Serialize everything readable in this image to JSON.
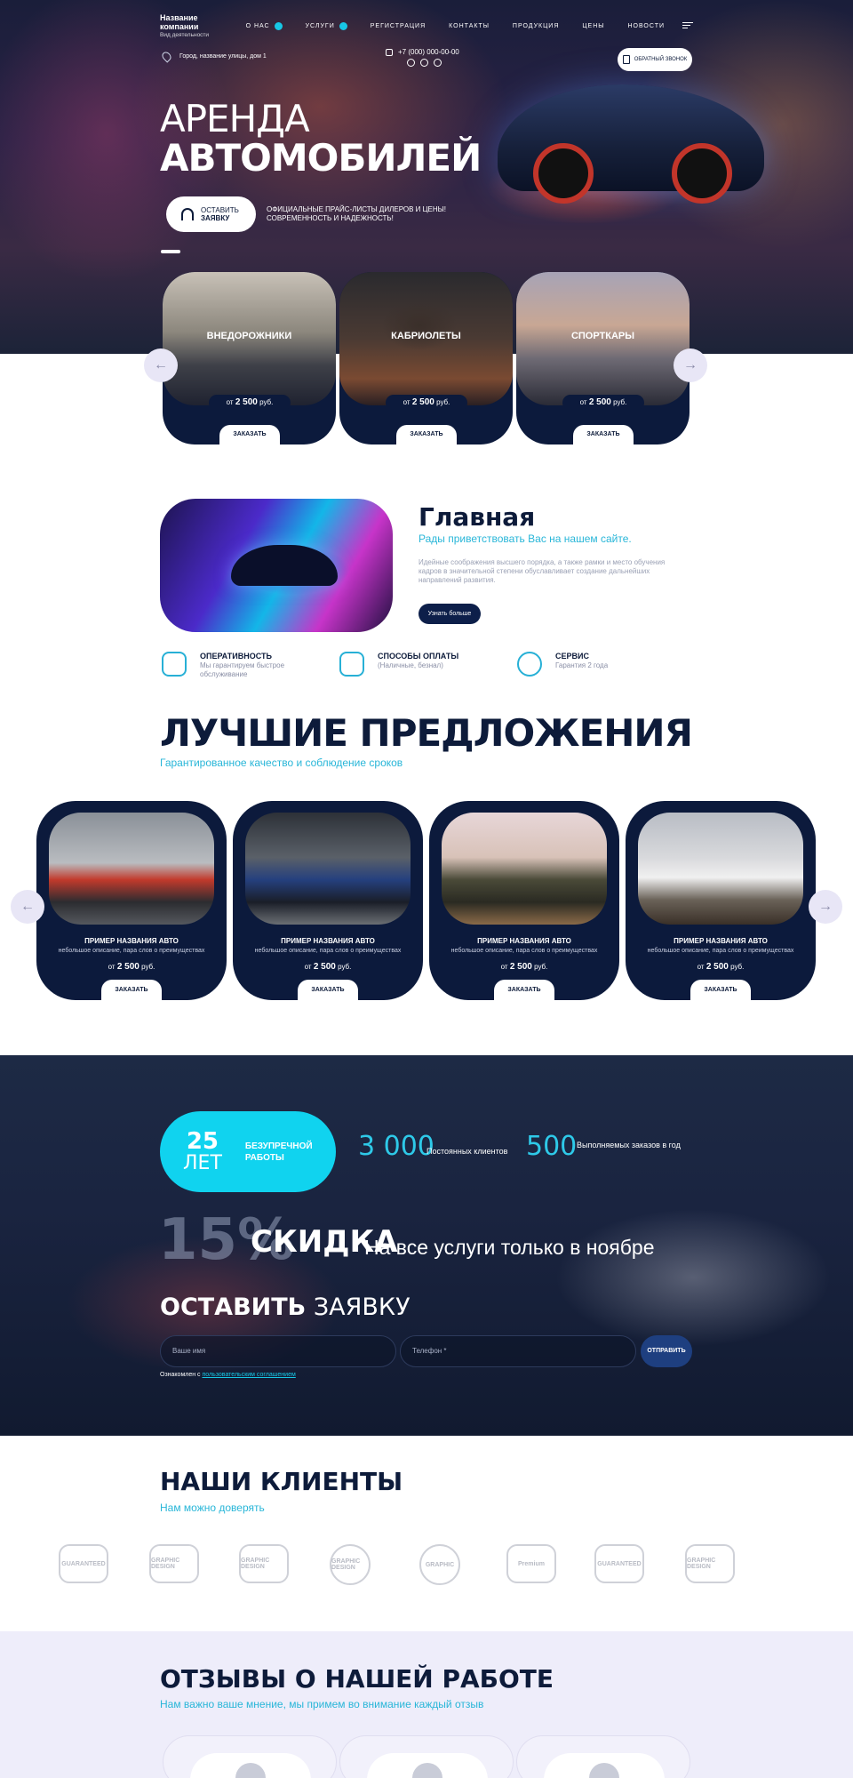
{
  "header": {
    "company_name": "Название компании",
    "company_sub": "Вид деятельности",
    "menu": [
      {
        "label": "О НАС",
        "has_dropdown": true
      },
      {
        "label": "УСЛУГИ",
        "has_dropdown": true
      },
      {
        "label": "РЕГИСТРАЦИЯ",
        "has_dropdown": false
      },
      {
        "label": "КОНТАКТЫ",
        "has_dropdown": false
      },
      {
        "label": "ПРОДУКЦИЯ",
        "has_dropdown": false
      },
      {
        "label": "ЦЕНЫ",
        "has_dropdown": false
      },
      {
        "label": "НОВОСТИ",
        "has_dropdown": false
      }
    ],
    "address": "Город, название улицы, дом 1",
    "phone": "+7 (000) 000-00-00",
    "callback_label": "ОБРАТНЫЙ ЗВОНОК",
    "icons": {
      "address": "map-pin-icon",
      "phone": "phone-icon",
      "callback": "document-icon",
      "menu": "hamburger-icon"
    }
  },
  "hero": {
    "title_line1": "АРЕНДА",
    "title_line2": "АВТОМОБИЛЕЙ",
    "cta_line1": "ОСТАВИТЬ",
    "cta_line2": "ЗАЯВКУ",
    "note": "ОФИЦИАЛЬНЫЕ ПРАЙС-ЛИСТЫ ДИЛЕРОВ И ЦЕНЫ! СОВРЕМЕННОСТЬ И НАДЕЖНОСТЬ!"
  },
  "categories": [
    {
      "label": "ВНЕДОРОЖНИКИ",
      "price_prefix": "от",
      "price": "2 500",
      "currency": "руб.",
      "order": "ЗАКАЗАТЬ"
    },
    {
      "label": "КАБРИОЛЕТЫ",
      "price_prefix": "от",
      "price": "2 500",
      "currency": "руб.",
      "order": "ЗАКАЗАТЬ"
    },
    {
      "label": "СПОРТКАРЫ",
      "price_prefix": "от",
      "price": "2 500",
      "currency": "руб.",
      "order": "ЗАКАЗАТЬ"
    }
  ],
  "about": {
    "title": "Главная",
    "subtitle": "Рады приветствовать Вас на нашем сайте.",
    "text": "Идейные соображения высшего порядка, а также рамки и место обучения кадров в значительной степени обуславливает создание дальнейших направлений развития.",
    "button": "Узнать больше"
  },
  "features": [
    {
      "title": "ОПЕРАТИВНОСТЬ",
      "text": "Мы гарантируем быстрое обслуживание",
      "icon": "car-icon"
    },
    {
      "title": "СПОСОБЫ ОПЛАТЫ",
      "text": "(Наличные, безнал)",
      "icon": "thumbs-up-icon"
    },
    {
      "title": "СЕРВИС",
      "text": "Гарантия 2 года",
      "icon": "badge-icon"
    }
  ],
  "best": {
    "title": "ЛУЧШИЕ ПРЕДЛОЖЕНИЯ",
    "subtitle": "Гарантированное качество и соблюдение сроков",
    "offers": [
      {
        "name": "ПРИМЕР НАЗВАНИЯ АВТО",
        "desc": "небольшое описание, пара слов о преимуществах",
        "price_prefix": "от",
        "price": "2 500",
        "currency": "руб.",
        "order": "ЗАКАЗАТЬ"
      },
      {
        "name": "ПРИМЕР НАЗВАНИЯ АВТО",
        "desc": "небольшое описание, пара слов о преимуществах",
        "price_prefix": "от",
        "price": "2 500",
        "currency": "руб.",
        "order": "ЗАКАЗАТЬ"
      },
      {
        "name": "ПРИМЕР НАЗВАНИЯ АВТО",
        "desc": "небольшое описание, пара слов о преимуществах",
        "price_prefix": "от",
        "price": "2 500",
        "currency": "руб.",
        "order": "ЗАКАЗАТЬ"
      },
      {
        "name": "ПРИМЕР НАЗВАНИЯ АВТО",
        "desc": "небольшое описание, пара слов о преимуществах",
        "price_prefix": "от",
        "price": "2 500",
        "currency": "руб.",
        "order": "ЗАКАЗАТЬ"
      }
    ]
  },
  "stats": {
    "years_num": "25",
    "years_unit": "ЛЕТ",
    "years_label": "БЕЗУПРЕЧНОЙ РАБОТЫ",
    "clients_num": "3 000",
    "clients_label": "Постоянных клиентов",
    "orders_num": "500",
    "orders_label": "Выполняемых заказов в год"
  },
  "discount": {
    "percent": "15%",
    "word": "СКИДКА",
    "text": "На все услуги только в ноябре"
  },
  "form": {
    "title_bold": "ОСТАВИТЬ",
    "title_rest": "ЗАЯВКУ",
    "name_placeholder": "Ваше имя",
    "phone_placeholder": "Телефон *",
    "submit": "ОТПРАВИТЬ",
    "agree_text": "Ознакомлен с",
    "agree_link": "пользовательским соглашением"
  },
  "clients": {
    "title": "НАШИ КЛИЕНТЫ",
    "subtitle": "Нам можно доверять",
    "logos": [
      "GUARANTEED",
      "GRAPHIC DESIGN",
      "GRAPHIC DESIGN",
      "GRAPHIC DESIGN",
      "GRAPHIC",
      "Premium",
      "GUARANTEED",
      "GRAPHIC DESIGN"
    ]
  },
  "reviews": {
    "title": "ОТЗЫВЫ О НАШЕЙ РАБОТЕ",
    "subtitle": "Нам важно ваше мнение, мы примем во внимание каждый отзыв"
  },
  "colors": {
    "accent": "#17c7e5",
    "navy": "#0c1a3c",
    "reviews_bg": "#eeedfa"
  }
}
